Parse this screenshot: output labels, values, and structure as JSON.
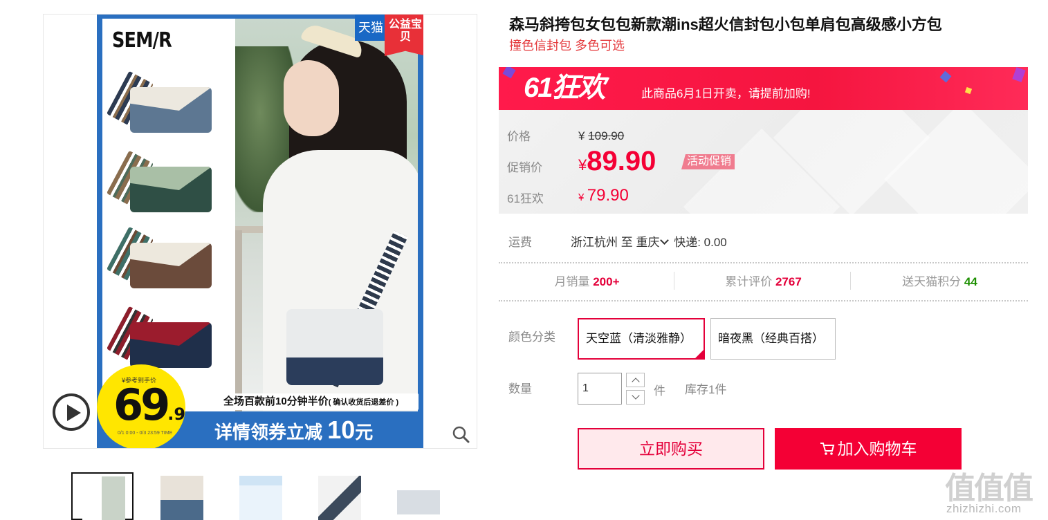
{
  "gallery": {
    "poster": {
      "brand": "SEM/R",
      "tag_tmall": "天猫",
      "tag_charity": "公益宝贝",
      "badge_price_main": "69",
      "badge_price_decimal": ".9",
      "badge_small_text": "¥参考到手价",
      "badge_tiny_text": "0/1 0:00 - 0/3 23:59 TIME",
      "banner_mid": "全场百款前10分钟半价",
      "banner_mid_note": "( 确认收货后退差价 )",
      "banner_bottom": "详情领券立减",
      "banner_bottom_amount": "10",
      "banner_bottom_unit": "元"
    },
    "play_icon": "play-circle-icon",
    "zoom_icon": "magnifier-icon",
    "thumbnails": [
      {
        "label": "thumbnail-1",
        "active": true
      },
      {
        "label": "thumbnail-2",
        "active": false
      },
      {
        "label": "thumbnail-3",
        "active": false
      },
      {
        "label": "thumbnail-4",
        "active": false
      },
      {
        "label": "thumbnail-5",
        "active": false
      }
    ]
  },
  "product": {
    "title": "森马斜挎包女包包新款潮ins超火信封包小包单肩包高级感小方包",
    "subtitle": "撞色信封包 多色可选"
  },
  "promo": {
    "logo": "61狂欢",
    "notice": "此商品6月1日开卖，请提前加购!"
  },
  "price": {
    "label_price": "价格",
    "label_promo": "促销价",
    "label_event": "61狂欢",
    "currency": "¥",
    "original": "109.90",
    "promo": "89.90",
    "promo_tag": "活动促销",
    "event": "79.90"
  },
  "shipping": {
    "label": "运费",
    "from": "浙江杭州",
    "to_word": "至",
    "to": "重庆",
    "method": "快递: 0.00"
  },
  "stats": {
    "monthly_label": "月销量",
    "monthly_value": "200+",
    "reviews_label": "累计评价",
    "reviews_value": "2767",
    "points_label": "送天猫积分",
    "points_value": "44"
  },
  "sku": {
    "label": "颜色分类",
    "options": [
      {
        "name": "天空蓝（清淡雅静）",
        "selected": true
      },
      {
        "name": "暗夜黑（经典百搭）",
        "selected": false
      }
    ]
  },
  "quantity": {
    "label": "数量",
    "value": "1",
    "unit": "件",
    "stock": "库存1件"
  },
  "actions": {
    "buy_now": "立即购买",
    "add_cart": "加入购物车"
  },
  "watermark": {
    "logo": "值值值",
    "url": "zhizhizhi.com"
  },
  "colors": {
    "accent": "#f40035",
    "promo_bar": "#ff1a4b",
    "tmall_blue": "#2a6fc0",
    "badge_yellow": "#ffe600",
    "points_green": "#1c8f00"
  }
}
